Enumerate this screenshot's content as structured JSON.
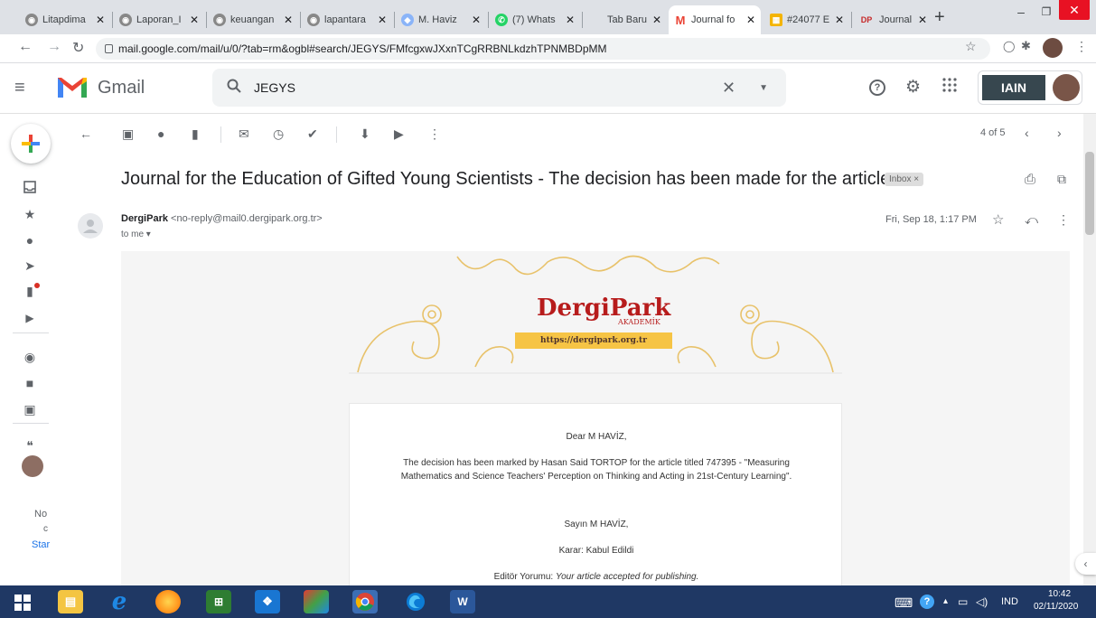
{
  "browser": {
    "tabs": [
      {
        "label": "Litapdima",
        "color": "#888888"
      },
      {
        "label": "Laporan_I",
        "color": "#888888"
      },
      {
        "label": "keuangan",
        "color": "#888888"
      },
      {
        "label": "lapantara",
        "color": "#888888"
      },
      {
        "label": "M. Haviz",
        "color": "#8ab4f8"
      },
      {
        "label": "(7) Whats",
        "color": "#25d366"
      },
      {
        "label": "Tab Baru",
        "color": ""
      },
      {
        "label": "Journal fo",
        "color": "#ea4335",
        "active": true
      },
      {
        "label": "#24077 E",
        "color": "#f4b400"
      },
      {
        "label": "Journal fo",
        "color": "#c62828"
      }
    ],
    "url": "mail.google.com/mail/u/0/?tab=rm&ogbl#search/JEGYS/FMfcgxwJXxnTCgRRBNLkdzhTPNMBDpMM"
  },
  "gmail": {
    "app_name": "Gmail",
    "search_value": "JEGYS",
    "org_logo_text": "IAIN",
    "pagination": "4 of 5",
    "rail_bottom_text": [
      "No",
      "c",
      "Star"
    ]
  },
  "email": {
    "subject": "Journal for the Education of Gifted Young Scientists - The decision has been made for the article",
    "label_chip": "Inbox ×",
    "sender_name": "DergiPark",
    "sender_email": "<no-reply@mail0.dergipark.org.tr>",
    "to_line": "to me ▾",
    "datetime": "Fri, Sep 18, 1:17 PM",
    "banner": {
      "brand": "DergiPark",
      "brand_sub": "AKADEMİK",
      "url": "https://dergipark.org.tr"
    },
    "body": {
      "greeting_en": "Dear M HAVİZ,",
      "line1": "The decision has been marked by Hasan Said TORTOP for the article titled 747395 - \"Measuring",
      "line2": "Mathematics and Science Teachers' Perception on Thinking and Acting in 21st-Century Learning\".",
      "greeting_tr": "Sayın M HAVİZ,",
      "decision": "Karar: Kabul Edildi",
      "editor_label": "Editör Yorumu:",
      "editor_comment": "Your article accepted for publishing."
    }
  },
  "taskbar": {
    "lang": "IND",
    "time": "10:42",
    "date": "02/11/2020"
  }
}
